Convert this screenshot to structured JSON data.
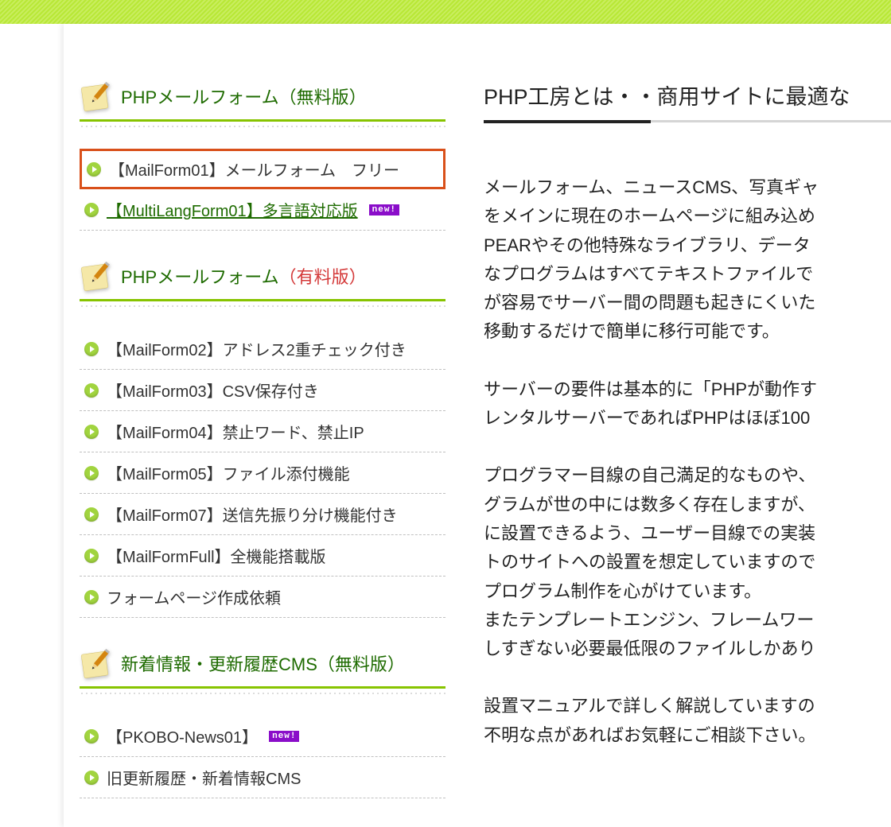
{
  "sidebar": {
    "sections": [
      {
        "title_prefix": "PHPメールフォーム",
        "title_suffix": "（無料版）",
        "paid": false,
        "items": [
          {
            "label": "【MailForm01】メールフォーム　フリー",
            "highlighted": true,
            "link": false,
            "new": false
          },
          {
            "label": "【MultiLangForm01】多言語対応版",
            "highlighted": false,
            "link": true,
            "new": true
          }
        ]
      },
      {
        "title_prefix": "PHPメールフォーム",
        "title_suffix": "（有料版）",
        "paid": true,
        "items": [
          {
            "label": "【MailForm02】アドレス2重チェック付き",
            "highlighted": false,
            "link": false,
            "new": false
          },
          {
            "label": "【MailForm03】CSV保存付き",
            "highlighted": false,
            "link": false,
            "new": false
          },
          {
            "label": "【MailForm04】禁止ワード、禁止IP",
            "highlighted": false,
            "link": false,
            "new": false
          },
          {
            "label": "【MailForm05】ファイル添付機能",
            "highlighted": false,
            "link": false,
            "new": false
          },
          {
            "label": "【MailForm07】送信先振り分け機能付き",
            "highlighted": false,
            "link": false,
            "new": false
          },
          {
            "label": "【MailFormFull】全機能搭載版",
            "highlighted": false,
            "link": false,
            "new": false
          },
          {
            "label": "フォームページ作成依頼",
            "highlighted": false,
            "link": false,
            "new": false
          }
        ]
      },
      {
        "title_prefix": "新着情報・更新履歴CMS",
        "title_suffix": "（無料版）",
        "paid": false,
        "items": [
          {
            "label": "【PKOBO-News01】",
            "highlighted": false,
            "link": false,
            "new": true
          },
          {
            "label": "旧更新履歴・新着情報CMS",
            "highlighted": false,
            "link": false,
            "new": false
          }
        ]
      }
    ]
  },
  "main": {
    "heading": "PHP工房とは・・商用サイトに最適な",
    "paragraphs": [
      "メールフォーム、ニュースCMS、写真ギャ\nをメインに現在のホームページに組み込め\nPEARやその他特殊なライブラリ、データ\nなプログラムはすべてテキストファイルで\nが容易でサーバー間の問題も起きにくいた\n移動するだけで簡単に移行可能です。",
      "サーバーの要件は基本的に「PHPが動作す\nレンタルサーバーであればPHPはほぼ100",
      "プログラマー目線の自己満足的なものや、\nグラムが世の中には数多く存在しますが、\nに設置できるよう、ユーザー目線での実装\nトのサイトへの設置を想定していますので\nプログラム制作を心がけています。\nまたテンプレートエンジン、フレームワー\nしすぎない必要最低限のファイルしかあり",
      "設置マニュアルで詳しく解説していますの\n不明な点があればお気軽にご相談下さい。"
    ]
  },
  "labels": {
    "new_badge": "new!"
  }
}
